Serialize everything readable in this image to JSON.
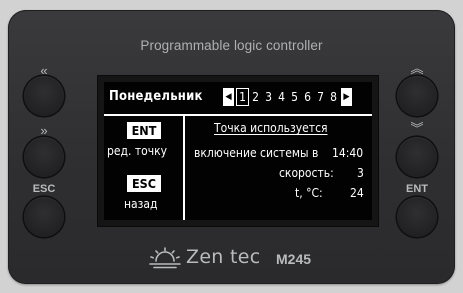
{
  "device": {
    "title": "Programmable logic controller",
    "brand": "Zen tec",
    "model": "M245"
  },
  "buttons": {
    "left_top_glyph": "«",
    "left_mid_glyph": "»",
    "left_bottom_label": "ESC",
    "right_top_glyph": "︽",
    "right_mid_glyph": "︾",
    "right_bottom_label": "ENT"
  },
  "screen": {
    "day": "Понедельник",
    "prev_arrow": "◀",
    "next_arrow": "▶",
    "points": [
      "1",
      "2",
      "3",
      "4",
      "5",
      "6",
      "7",
      "8"
    ],
    "selected_point": "1",
    "ent_key": "ENT",
    "ent_action": "ред. точку",
    "esc_key": "ESC",
    "esc_action": "назад",
    "status": "Точка используется",
    "line1_label": "включение системы в",
    "line1_value": "14:40",
    "line2_label": "скорость:",
    "line2_value": "3",
    "line3_label": "t, °C:",
    "line3_value": "24"
  },
  "colors": {
    "panel": "#323234",
    "lcd_bg": "#020202",
    "lcd_fg": "#ffffff",
    "brand": "#b9bbbe"
  }
}
